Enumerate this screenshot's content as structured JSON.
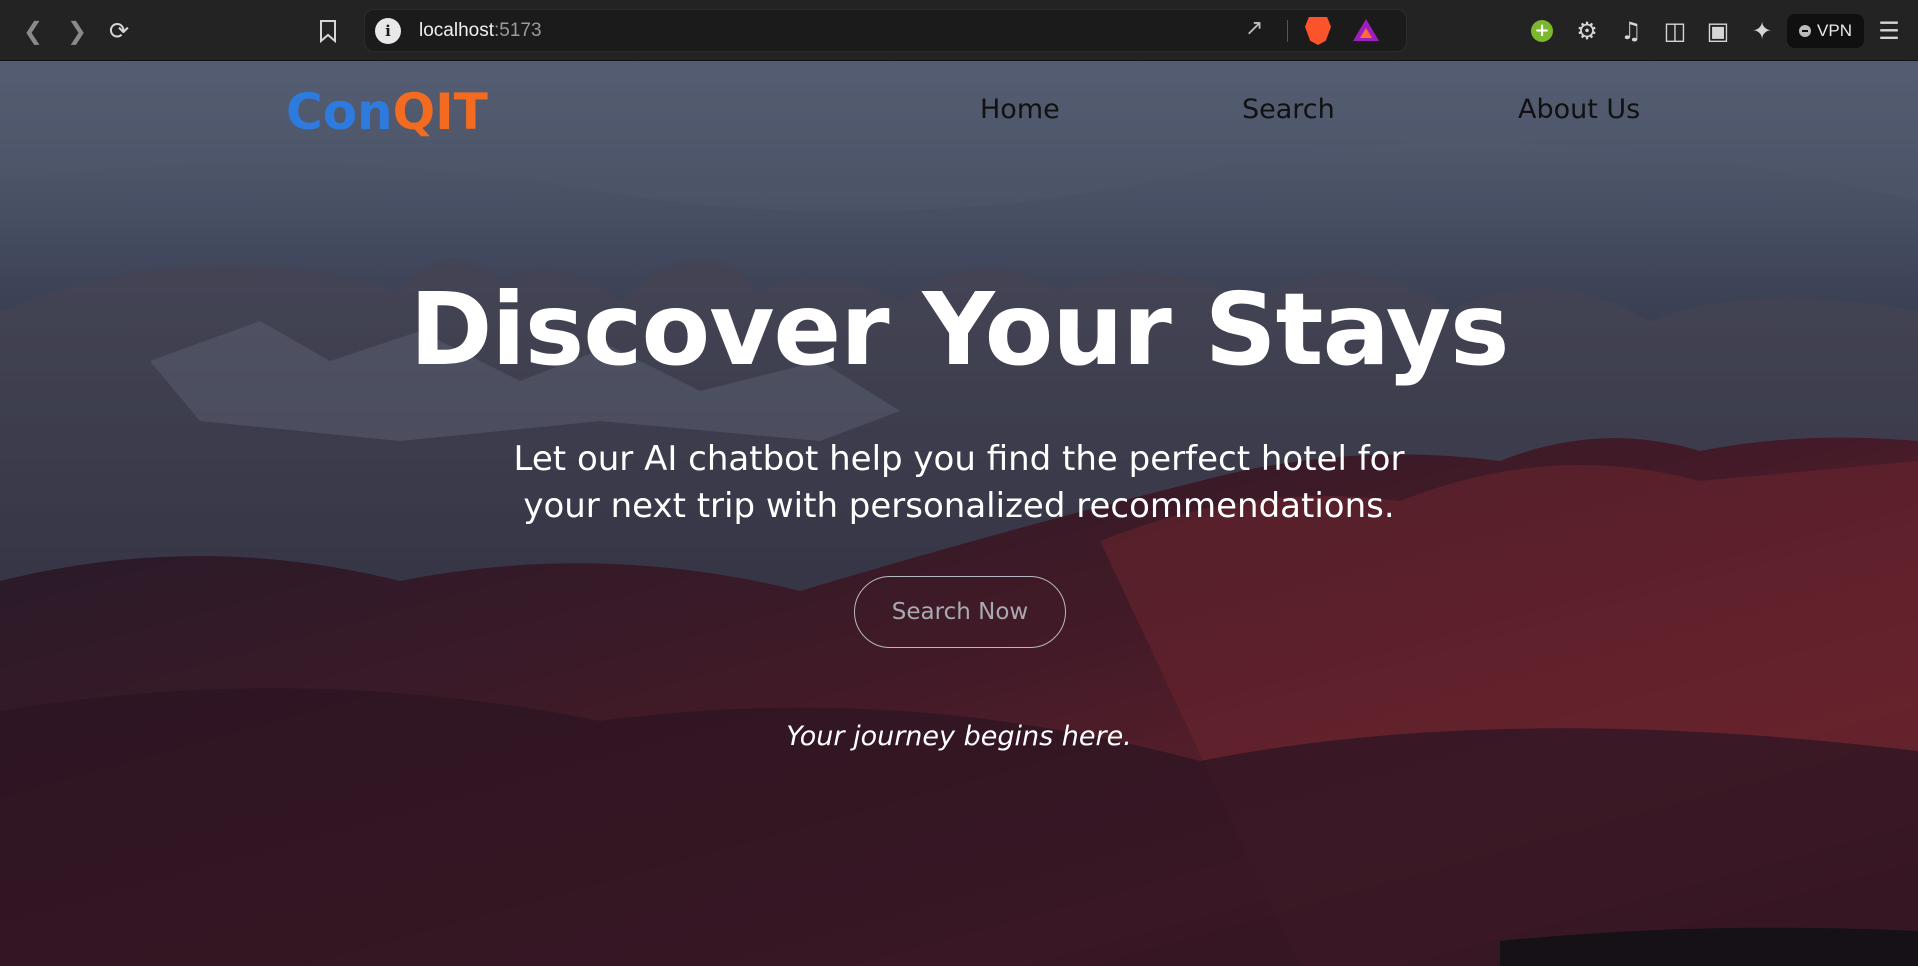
{
  "browser": {
    "url_host": "localhost",
    "url_port": ":5173",
    "vpn_label": "VPN"
  },
  "site": {
    "logo_part1": "Con",
    "logo_part2": "QIT",
    "logo_colors": {
      "primary": "#2e7be0",
      "secondary": "#f26b21"
    },
    "nav": [
      {
        "label": "Home"
      },
      {
        "label": "Search"
      },
      {
        "label": "About Us"
      }
    ]
  },
  "hero": {
    "title": "Discover Your Stays",
    "subtitle_line1": "Let our AI chatbot help you find the perfect hotel for",
    "subtitle_line2": "your next trip with personalized recommendations.",
    "cta_label": "Search Now",
    "tagline": "Your journey begins here."
  }
}
